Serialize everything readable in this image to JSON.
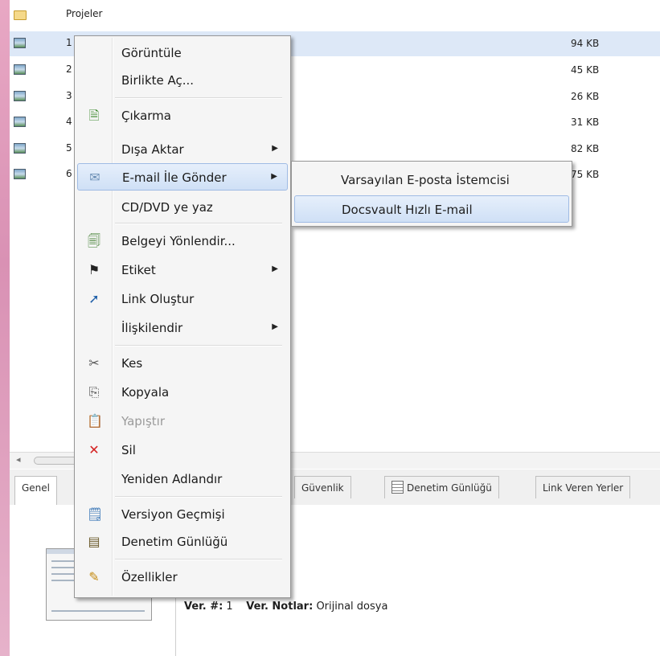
{
  "file_list": {
    "folder": {
      "name": "Projeler"
    },
    "rows": [
      {
        "name": "1",
        "size": "94 KB"
      },
      {
        "name": "2",
        "size": "45 KB"
      },
      {
        "name": "3",
        "size": "26 KB"
      },
      {
        "name": "4",
        "size": "31 KB"
      },
      {
        "name": "5",
        "size": "82 KB"
      },
      {
        "name": "6",
        "size": "75 KB"
      }
    ]
  },
  "context_menu": {
    "open": "Görüntüle",
    "open_with": "Birlikte Aç...",
    "extract": "Çıkarma",
    "export": "Dışa Aktar",
    "send_email": "E-mail İle Gönder",
    "burn": "CD/DVD ye yaz",
    "route_doc": "Belgeyi Yönlendir...",
    "tag": "Etiket",
    "create_link": "Link Oluştur",
    "relate": "İlişkilendir",
    "cut": "Kes",
    "copy": "Kopyala",
    "paste": "Yapıştır",
    "delete": "Sil",
    "rename": "Yeniden Adlandır",
    "version_history": "Versiyon Geçmişi",
    "audit_log": "Denetim Günlüğü",
    "properties": "Özellikler"
  },
  "submenu": {
    "default_client": "Varsayılan E-posta İstemcisi",
    "quick_email": "Docsvault Hızlı E-mail"
  },
  "tabs": {
    "general": "Genel",
    "security": "Güvenlik",
    "audit_log": "Denetim Günlüğü",
    "link_sources": "Link Veren Yerler"
  },
  "details": {
    "version_label": "Ver. #:",
    "version_value": "1",
    "notes_label": "Ver. Notlar:",
    "notes_value": "Orijinal dosya"
  },
  "colors": {
    "selection": "#dde8f7",
    "highlight_border": "#9fbbe4",
    "left_strip": "#d991b4"
  }
}
